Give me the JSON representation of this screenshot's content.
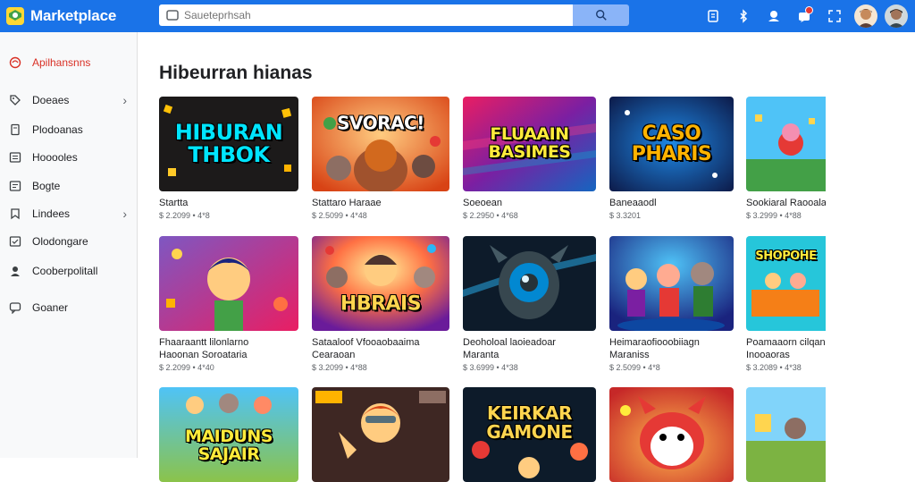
{
  "app": {
    "title": "Marketplace"
  },
  "search": {
    "placeholder": "Saueteprhsah"
  },
  "topbar_icons": [
    "cart-icon",
    "bluetooth-icon",
    "cloud-icon",
    "notification-icon",
    "fullscreen-icon"
  ],
  "sidebar": {
    "items": [
      {
        "label": "Apilhansnns",
        "icon": "apps-icon",
        "active": true
      },
      {
        "label": "Doeaes",
        "icon": "tag-icon",
        "chevron": true
      },
      {
        "label": "Plodoanas",
        "icon": "document-icon"
      },
      {
        "label": "Hooooles",
        "icon": "list-icon"
      },
      {
        "label": "Bogte",
        "icon": "list-icon"
      },
      {
        "label": "Lindees",
        "icon": "bookmark-icon",
        "chevron": true
      },
      {
        "label": "Olodongare",
        "icon": "checklist-icon"
      },
      {
        "label": "Cooberpolitall",
        "icon": "user-icon"
      },
      {
        "label": "Goaner",
        "icon": "comment-icon"
      }
    ]
  },
  "main": {
    "title": "Hibeurran hianas",
    "cards": [
      {
        "thumb_text": "HIBURAN THBOK",
        "name": "Startta",
        "name2": "",
        "meta": "$ 2.2099 • 4*8"
      },
      {
        "thumb_text": "SVORAC!",
        "name": "Stattaro Haraae",
        "name2": "",
        "meta": "$ 2.5099 • 4*48"
      },
      {
        "thumb_text": "FLUAAIN BASIMES",
        "name": "Soeoean",
        "name2": "",
        "meta": "$ 2.2950 • 4*68"
      },
      {
        "thumb_text": "CASO PHARIS",
        "name": "Baneaaodl",
        "name2": "",
        "meta": "$ 3.3201"
      },
      {
        "thumb_text": "",
        "name": "Sookiaral Raooala",
        "name2": "",
        "meta": "$ 3.2999 • 4*88"
      },
      {
        "thumb_text": "",
        "name": "Fhaaraantt lilonlarno",
        "name2": "Haoonan Soroataria",
        "meta": "$ 2.2099 • 4*40"
      },
      {
        "thumb_text": "HBRAIS",
        "name": "Sataaloof Vfooaobaaima",
        "name2": "Cearaoan",
        "meta": "$ 3.2099 • 4*88"
      },
      {
        "thumb_text": "",
        "name": "Deoholoal laoieadoar",
        "name2": "Maranta",
        "meta": "$ 3.6999 • 4*38"
      },
      {
        "thumb_text": "",
        "name": "Heimaraofiooobiiagn",
        "name2": "Maraniss",
        "meta": "$ 2.5099 • 4*8"
      },
      {
        "thumb_text": "SHOPOHE",
        "name": "Poamaaorn cilqanita",
        "name2": "Inooaoras",
        "meta": "$ 3.2089 • 4*38"
      },
      {
        "thumb_text": "MAIDUNS SAJAIR",
        "name": "",
        "name2": "",
        "meta": ""
      },
      {
        "thumb_text": "",
        "name": "",
        "name2": "",
        "meta": ""
      },
      {
        "thumb_text": "KEIRKAR GAMONE",
        "name": "",
        "name2": "",
        "meta": ""
      },
      {
        "thumb_text": "",
        "name": "",
        "name2": "",
        "meta": ""
      },
      {
        "thumb_text": "",
        "name": "",
        "name2": "",
        "meta": ""
      }
    ]
  },
  "colors": {
    "topbar": "#1a73e8",
    "search_button": "#8ab4f8",
    "active_item": "#d93025",
    "sidebar_bg": "#f8f9fa"
  }
}
